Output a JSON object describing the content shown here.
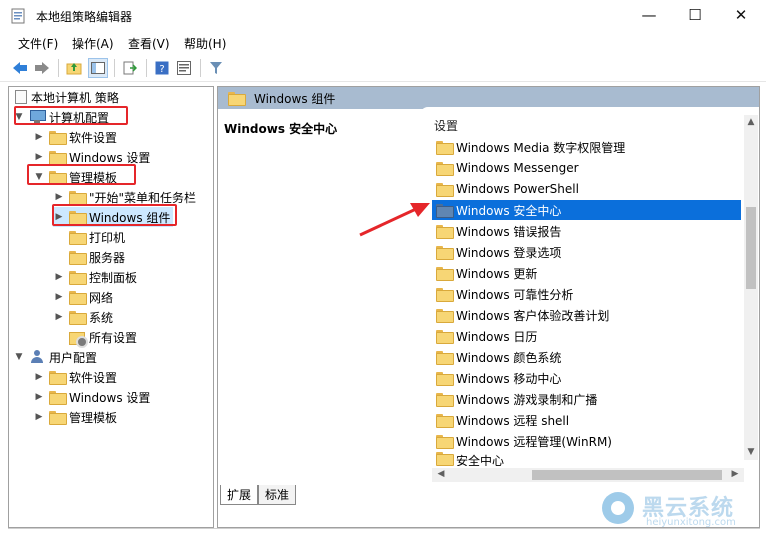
{
  "window": {
    "title": "本地组策略编辑器",
    "controls": {
      "minimize": "—",
      "maximize": "☐",
      "close": "✕"
    }
  },
  "menu": [
    "文件(F)",
    "操作(A)",
    "查看(V)",
    "帮助(H)"
  ],
  "toolbar_icons": [
    "back-arrow-icon",
    "forward-arrow-icon",
    "up-folder-icon",
    "show-hide-tree-icon",
    "export-list-icon",
    "help-icon",
    "properties-icon",
    "filter-icon"
  ],
  "tree": {
    "root": "本地计算机 策略",
    "computer_config": "计算机配置",
    "software_settings": "软件设置",
    "windows_settings": "Windows 设置",
    "admin_templates": "管理模板",
    "start_menu": "\"开始\"菜单和任务栏",
    "windows_components": "Windows 组件",
    "printers": "打印机",
    "server": "服务器",
    "control_panel": "控制面板",
    "network": "网络",
    "system": "系统",
    "all_settings": "所有设置",
    "user_config": "用户配置",
    "user_software_settings": "软件设置",
    "user_windows_settings": "Windows 设置",
    "user_admin_templates": "管理模板"
  },
  "right_pane": {
    "header": "Windows 组件",
    "description_title": "Windows 安全中心",
    "list_header": "设置",
    "items": [
      "Windows Media 数字权限管理",
      "Windows Messenger",
      "Windows PowerShell",
      "Windows 安全中心",
      "Windows 错误报告",
      "Windows 登录选项",
      "Windows 更新",
      "Windows 可靠性分析",
      "Windows 客户体验改善计划",
      "Windows 日历",
      "Windows 颜色系统",
      "Windows 移动中心",
      "Windows 游戏录制和广播",
      "Windows 远程 shell",
      "Windows 远程管理(WinRM)",
      "安全中心"
    ],
    "selected_item": "Windows 安全中心",
    "tabs": [
      "扩展",
      "标准"
    ],
    "active_tab": "扩展"
  },
  "watermark": {
    "title": "黑云系统",
    "url": "heiyunxitong.com"
  },
  "colors": {
    "selection": "#0b6fdb",
    "annotation": "#e5262a",
    "header_bar": "#a8bbd0"
  }
}
